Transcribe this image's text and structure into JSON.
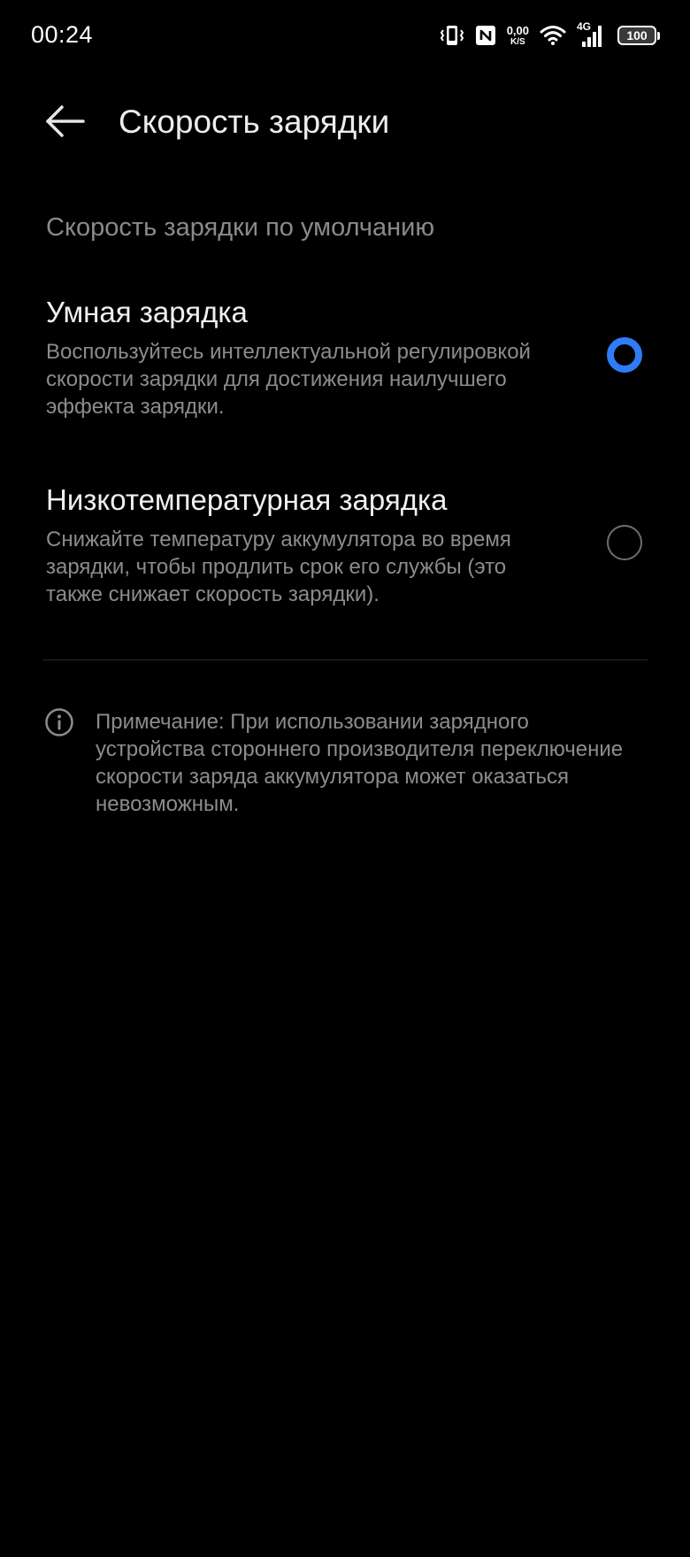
{
  "status_bar": {
    "time": "00:24",
    "net_speed_value": "0,00",
    "net_speed_unit": "K/S",
    "network_type": "4G",
    "battery_level": "100",
    "icons": [
      "vibrate-icon",
      "nfc-icon",
      "wifi-icon",
      "cell-signal-icon",
      "battery-icon"
    ]
  },
  "header": {
    "back_icon": "arrow-left-icon",
    "title": "Скорость зарядки"
  },
  "section": {
    "label": "Скорость зарядки по умолчанию"
  },
  "options": [
    {
      "title": "Умная зарядка",
      "description": "Воспользуйтесь интеллектуальной регулировкой скорости зарядки для достижения наилучшего эффекта зарядки.",
      "selected": true
    },
    {
      "title": "Низкотемпературная зарядка",
      "description": "Снижайте температуру аккумулятора во время зарядки, чтобы продлить срок его службы (это также снижает скорость зарядки).",
      "selected": false
    }
  ],
  "note": {
    "icon": "info-icon",
    "text": "Примечание: При использовании зарядного устройства стороннего производителя переключение скорости заряда аккумулятора может оказаться невозможным."
  },
  "colors": {
    "background": "#000000",
    "accent": "#2f7cf6",
    "primary_text": "#f0f0f0",
    "secondary_text": "#8c8c8c"
  }
}
